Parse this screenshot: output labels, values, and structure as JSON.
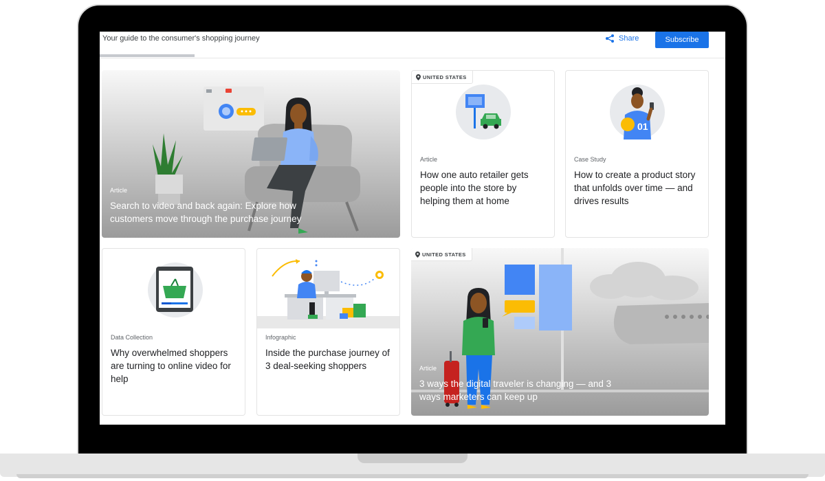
{
  "header": {
    "tagline": "Your guide to the consumer's shopping journey",
    "share_label": "Share",
    "subscribe_label": "Subscribe"
  },
  "cards": [
    {
      "category": "Article",
      "title": "Search to video and back again: Explore how customers move through the purchase journey"
    },
    {
      "badge": "UNITED STATES",
      "category": "Article",
      "title": "How one auto retailer gets people into the store by helping them at home"
    },
    {
      "category": "Case Study",
      "title": "How to create a product story that unfolds over time — and drives results"
    },
    {
      "category": "Data Collection",
      "title": "Why overwhelmed shoppers are turning to online video for help"
    },
    {
      "category": "Infographic",
      "title": "Inside the purchase journey of 3 deal-seeking shoppers"
    },
    {
      "badge": "UNITED STATES",
      "category": "Article",
      "title": "3 ways the digital traveler is changing — and 3 ways marketers can keep up"
    }
  ],
  "illustration_text": {
    "jersey_number": "01"
  },
  "colors": {
    "accent": "#1a73e8",
    "plant_green": "#2e7d32",
    "car_green": "#34a853",
    "badge_text": "#3c4043"
  }
}
